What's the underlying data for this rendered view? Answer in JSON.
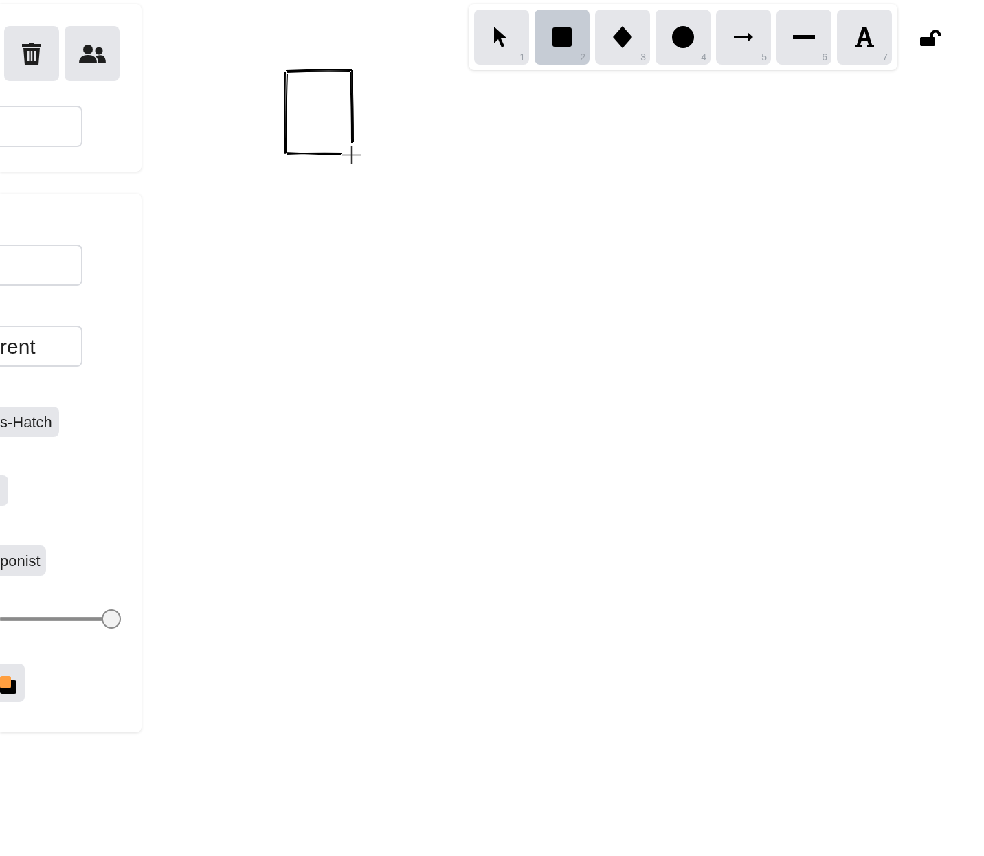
{
  "actions_panel": {
    "buttons": [
      {
        "kind": "delete"
      },
      {
        "kind": "collaborate"
      }
    ]
  },
  "properties_panel": {
    "field_2": {
      "value": "rent"
    },
    "fill_option": {
      "label": "s-Hatch",
      "selected": true
    },
    "stroke_option": {
      "selected": true
    },
    "font_option": {
      "label": "ponist",
      "selected": true
    },
    "opacity": {
      "level": 1
    },
    "layer_button": {
      "kind": "layers"
    }
  },
  "toolbar": {
    "tools": [
      {
        "kind": "select",
        "key": "1",
        "selected": false
      },
      {
        "kind": "rectangle",
        "key": "2",
        "selected": true
      },
      {
        "kind": "diamond",
        "key": "3",
        "selected": false
      },
      {
        "kind": "ellipse",
        "key": "4",
        "selected": false
      },
      {
        "kind": "arrow",
        "key": "5",
        "selected": false
      },
      {
        "kind": "line",
        "key": "6",
        "selected": false
      },
      {
        "kind": "text",
        "key": "7",
        "selected": false
      }
    ],
    "locked": false
  }
}
